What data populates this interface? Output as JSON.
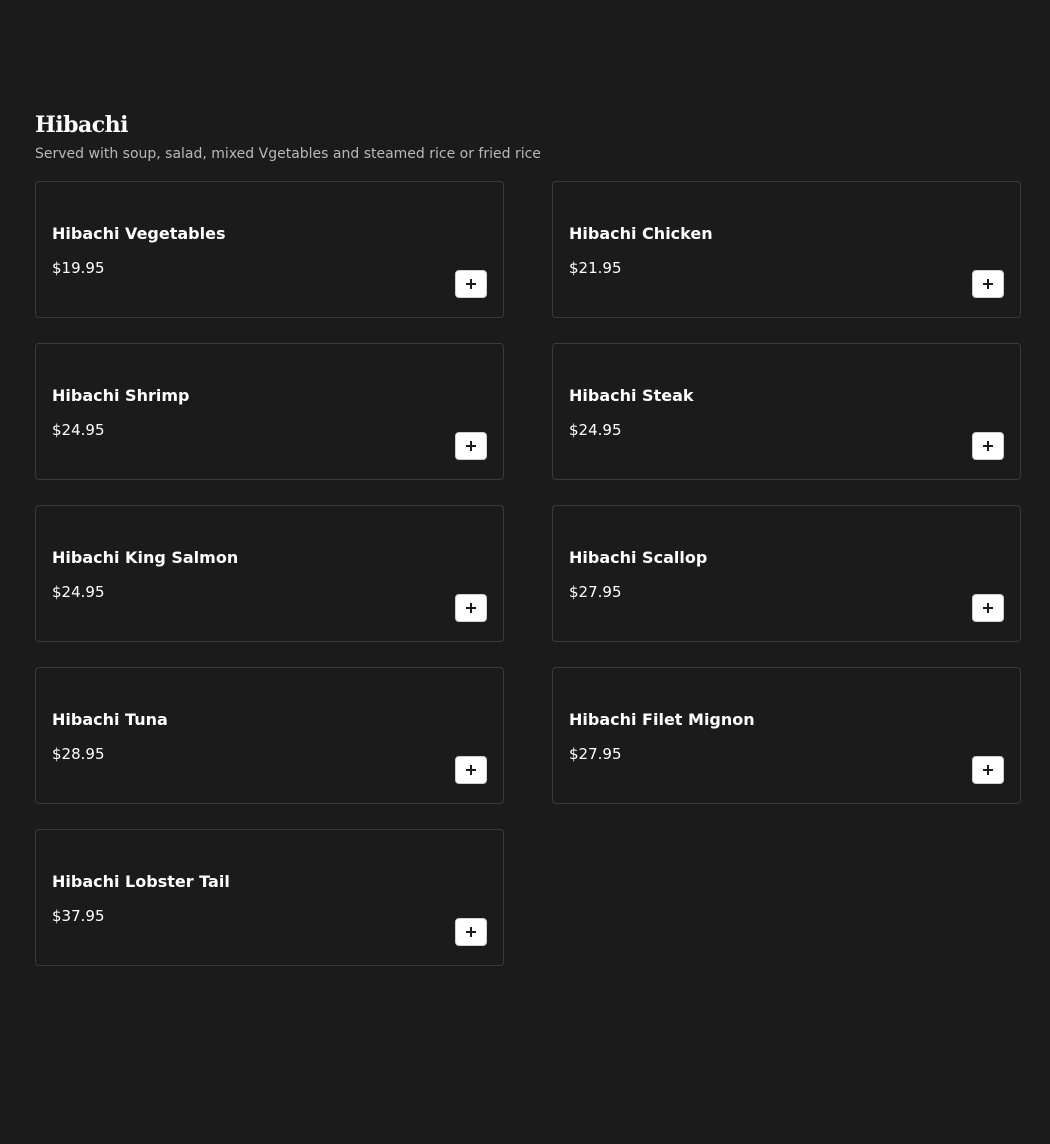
{
  "section": {
    "title": "Hibachi",
    "description": "Served with soup, salad, mixed Vgetables and steamed rice or fried rice"
  },
  "items": [
    {
      "name": "Hibachi Vegetables",
      "price": "$19.95"
    },
    {
      "name": "Hibachi Chicken",
      "price": "$21.95"
    },
    {
      "name": "Hibachi Shrimp",
      "price": "$24.95"
    },
    {
      "name": "Hibachi Steak",
      "price": "$24.95"
    },
    {
      "name": "Hibachi King Salmon",
      "price": "$24.95"
    },
    {
      "name": "Hibachi Scallop",
      "price": "$27.95"
    },
    {
      "name": "Hibachi Tuna",
      "price": "$28.95"
    },
    {
      "name": "Hibachi Filet Mignon",
      "price": "$27.95"
    },
    {
      "name": "Hibachi Lobster Tail",
      "price": "$37.95"
    }
  ],
  "add_button": {
    "icon": "plus-icon"
  },
  "colors": {
    "background": "#1b1b1b",
    "card_border": "#3a3a3a",
    "text": "#ffffff",
    "muted_text": "#b8b8b8",
    "button_bg": "#ffffff"
  }
}
